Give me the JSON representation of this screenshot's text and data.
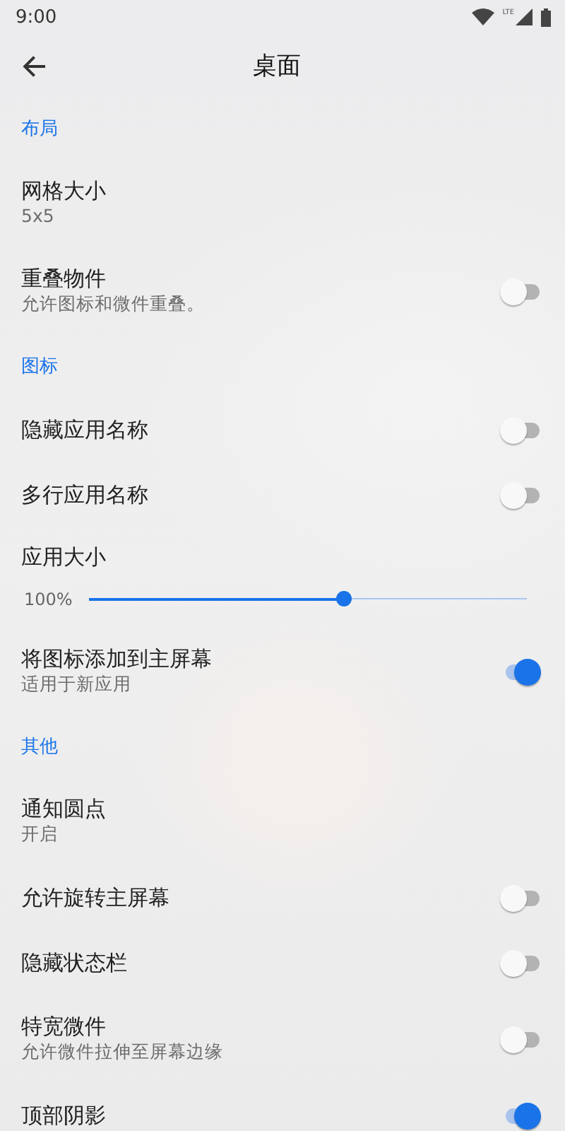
{
  "status_bar": {
    "time": "9:00",
    "network": "LTE"
  },
  "toolbar": {
    "title": "桌面"
  },
  "sections": [
    {
      "header": "布局",
      "items": [
        {
          "kind": "text",
          "title": "网格大小",
          "subtitle": "5x5"
        },
        {
          "kind": "switch",
          "title": "重叠物件",
          "subtitle": "允许图标和微件重叠。",
          "on": false
        }
      ]
    },
    {
      "header": "图标",
      "items": [
        {
          "kind": "switch",
          "title": "隐藏应用名称",
          "on": false
        },
        {
          "kind": "switch",
          "title": "多行应用名称",
          "on": false
        },
        {
          "kind": "slider",
          "title": "应用大小",
          "reading": "100%",
          "level": 0.58
        },
        {
          "kind": "switch",
          "title": "将图标添加到主屏幕",
          "subtitle": "适用于新应用",
          "on": true
        }
      ]
    },
    {
      "header": "其他",
      "items": [
        {
          "kind": "text",
          "title": "通知圆点",
          "subtitle": "开启"
        },
        {
          "kind": "switch",
          "title": "允许旋转主屏幕",
          "on": false
        },
        {
          "kind": "switch",
          "title": "隐藏状态栏",
          "on": false
        },
        {
          "kind": "switch",
          "title": "特宽微件",
          "subtitle": "允许微件拉伸至屏幕边缘",
          "on": false
        },
        {
          "kind": "switch",
          "title": "顶部阴影",
          "on": true
        }
      ]
    }
  ]
}
